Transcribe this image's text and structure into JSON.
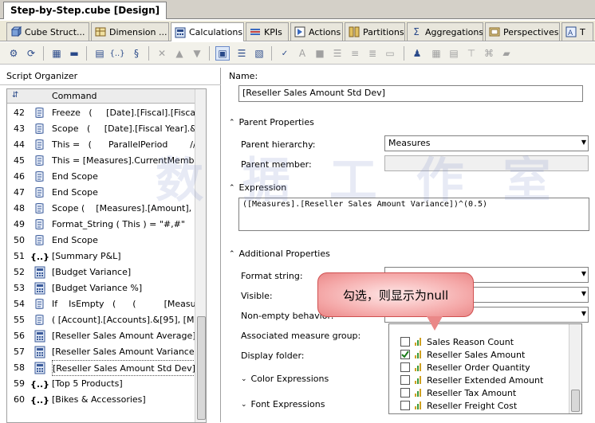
{
  "document_tab": "Step-by-Step.cube [Design]",
  "designer_tabs": [
    {
      "label": "Cube Struct...",
      "icon": "cube-structure-icon"
    },
    {
      "label": "Dimension ...",
      "icon": "dimension-usage-icon"
    },
    {
      "label": "Calculations",
      "icon": "calculations-icon",
      "active": true
    },
    {
      "label": "KPIs",
      "icon": "kpi-icon"
    },
    {
      "label": "Actions",
      "icon": "actions-icon"
    },
    {
      "label": "Partitions",
      "icon": "partitions-icon"
    },
    {
      "label": "Aggregations",
      "icon": "aggregations-icon"
    },
    {
      "label": "Perspectives",
      "icon": "perspectives-icon"
    },
    {
      "label": "T",
      "icon": "translations-icon"
    }
  ],
  "script_organizer": {
    "title": "Script Organizer",
    "column_header": "Command",
    "rows": [
      {
        "num": "42",
        "type": "script",
        "command": "Freeze   (     [Date].[Fiscal].[Fiscal ..."
      },
      {
        "num": "43",
        "type": "script",
        "command": "Scope   (     [Date].[Fiscal Year].&[..."
      },
      {
        "num": "44",
        "type": "script",
        "command": "This =   (      ParallelPeriod        // ..."
      },
      {
        "num": "45",
        "type": "script",
        "command": "This = [Measures].CurrentMember ..."
      },
      {
        "num": "46",
        "type": "script",
        "command": "End Scope"
      },
      {
        "num": "47",
        "type": "script",
        "command": "End Scope"
      },
      {
        "num": "48",
        "type": "script",
        "command": "Scope (    [Measures].[Amount],   {..."
      },
      {
        "num": "49",
        "type": "script",
        "command": "Format_String ( This ) = \"#,#\""
      },
      {
        "num": "50",
        "type": "script",
        "command": "End Scope"
      },
      {
        "num": "51",
        "type": "named-set",
        "command": "[Summary P&L]"
      },
      {
        "num": "52",
        "type": "calc",
        "command": "[Budget Variance]"
      },
      {
        "num": "53",
        "type": "calc",
        "command": "[Budget Variance %]"
      },
      {
        "num": "54",
        "type": "script",
        "command": "If    IsEmpty   (      (          [Measu..."
      },
      {
        "num": "55",
        "type": "script",
        "command": "( [Account].[Accounts].&[95], [Me..."
      },
      {
        "num": "56",
        "type": "calc",
        "command": "[Reseller Sales Amount Average]"
      },
      {
        "num": "57",
        "type": "calc",
        "command": "[Reseller Sales Amount Variance]"
      },
      {
        "num": "58",
        "type": "calc",
        "command": "[Reseller Sales Amount Std Dev]",
        "selected": true
      },
      {
        "num": "59",
        "type": "named-set",
        "command": "[Top 5 Products]"
      },
      {
        "num": "60",
        "type": "named-set",
        "command": "[Bikes & Accessories]"
      }
    ]
  },
  "properties": {
    "name_label": "Name:",
    "name_value": "[Reseller Sales Amount Std Dev]",
    "parent_section": "Parent Properties",
    "parent_hierarchy_label": "Parent hierarchy:",
    "parent_hierarchy_value": "Measures",
    "parent_member_label": "Parent member:",
    "expression_section": "Expression",
    "expression_value": "([Measures].[Reseller Sales Amount Variance])^(0.5)",
    "additional_section": "Additional Properties",
    "format_string_label": "Format string:",
    "visible_label": "Visible:",
    "non_empty_label": "Non-empty behavior:",
    "assoc_group_label": "Associated measure group:",
    "display_folder_label": "Display folder:",
    "color_expressions": "Color Expressions",
    "font_expressions": "Font Expressions"
  },
  "measure_list": [
    {
      "label": "Sales Reason Count",
      "checked": false
    },
    {
      "label": "Reseller Sales Amount",
      "checked": true
    },
    {
      "label": "Reseller Order Quantity",
      "checked": false
    },
    {
      "label": "Reseller Extended Amount",
      "checked": false
    },
    {
      "label": "Reseller Tax Amount",
      "checked": false
    },
    {
      "label": "Reseller Freight Cost",
      "checked": false
    }
  ],
  "callout_text": "勾选，则显示为null",
  "watermark_text": "数 据 工 作 室",
  "colors": {
    "highlight": "#ffff00",
    "callout": "#f4a6a6",
    "selected_row_border": "#555555"
  }
}
